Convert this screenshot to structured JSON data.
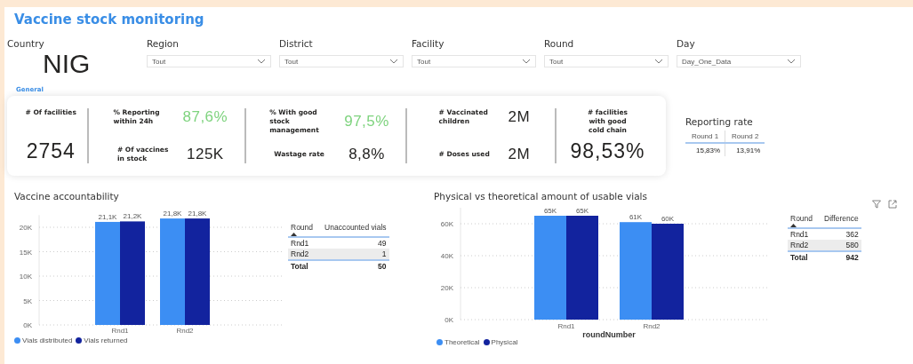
{
  "title": "Vaccine stock monitoring",
  "country": {
    "label": "Country",
    "value": "NIG"
  },
  "filters": [
    {
      "label": "Region",
      "value": "Tout"
    },
    {
      "label": "District",
      "value": "Tout"
    },
    {
      "label": "Facility",
      "value": "Tout"
    },
    {
      "label": "Round",
      "value": "Tout"
    },
    {
      "label": "Day",
      "value": "Day_One_Data"
    }
  ],
  "section_label": "General",
  "kpis": [
    {
      "kind": "single",
      "label": "# Of facilities",
      "value": "2754"
    },
    {
      "kind": "pair",
      "items": [
        {
          "label": "% Reporting within 24h",
          "value": "87,6%",
          "color": "#7ed37e"
        },
        {
          "label": "# Of  vaccines in stock",
          "value": "125K",
          "color": "#252423"
        }
      ]
    },
    {
      "kind": "pair",
      "items": [
        {
          "label": "% With good stock management",
          "value": "97,5%",
          "color": "#7ed37e"
        },
        {
          "label": "Wastage rate",
          "value": "8,8%",
          "color": "#252423"
        }
      ]
    },
    {
      "kind": "pair",
      "items": [
        {
          "label": "# Vaccinated children",
          "value": "2M",
          "color": "#252423"
        },
        {
          "label": "# Doses used",
          "value": "2M",
          "color": "#252423"
        }
      ]
    },
    {
      "kind": "single",
      "label": "# facilities with good cold chain",
      "value": "98,53%"
    }
  ],
  "reporting_rate": {
    "title": "Reporting rate",
    "columns": [
      "Round 1",
      "Round 2"
    ],
    "rows": [
      [
        "15,83%",
        "13,91%"
      ]
    ]
  },
  "charts": [
    {
      "title": "Vaccine accountability",
      "chart_data": {
        "type": "bar",
        "categories": [
          "Rnd1",
          "Rnd2"
        ],
        "grid": true,
        "ylim": [
          0,
          22500
        ],
        "yticks": [
          {
            "value": 0,
            "label": "0K"
          },
          {
            "value": 5000,
            "label": "5K"
          },
          {
            "value": 10000,
            "label": "10K"
          },
          {
            "value": 15000,
            "label": "15K"
          },
          {
            "value": 20000,
            "label": "20K"
          }
        ],
        "data_labels": true,
        "series": [
          {
            "name": "Vials distributed",
            "color": "#3c8ef3",
            "values": [
              21100,
              21800
            ],
            "value_labels": [
              "21,1K",
              "21,8K"
            ]
          },
          {
            "name": "Vials returned",
            "color": "#12239e",
            "values": [
              21200,
              21800
            ],
            "value_labels": [
              "21,2K",
              "21,8K"
            ]
          }
        ]
      },
      "table": {
        "columns": [
          "Round",
          "Unaccounted vials"
        ],
        "rows": [
          {
            "cells": [
              "Rnd1",
              "49"
            ],
            "highlighted": false
          },
          {
            "cells": [
              "Rnd2",
              "1"
            ],
            "highlighted": true
          }
        ],
        "total": [
          "Total",
          "50"
        ]
      }
    },
    {
      "title": "Physical vs theoretical amount of usable vials",
      "chart_data": {
        "type": "bar",
        "categories": [
          "Rnd1",
          "Rnd2"
        ],
        "xlabel": "roundNumber",
        "grid": true,
        "ylim": [
          0,
          70000
        ],
        "yticks": [
          {
            "value": 0,
            "label": "0K"
          },
          {
            "value": 20000,
            "label": "20K"
          },
          {
            "value": 40000,
            "label": "40K"
          },
          {
            "value": 60000,
            "label": "60K"
          }
        ],
        "data_labels": true,
        "series": [
          {
            "name": "Theoretical",
            "color": "#3c8ef3",
            "values": [
              65000,
              61000
            ],
            "value_labels": [
              "65K",
              "61K"
            ]
          },
          {
            "name": "Physical",
            "color": "#12239e",
            "values": [
              65000,
              60000
            ],
            "value_labels": [
              "65K",
              "60K"
            ]
          }
        ]
      },
      "table": {
        "columns": [
          "Round",
          "Difference"
        ],
        "rows": [
          {
            "cells": [
              "Rnd1",
              "362"
            ],
            "highlighted": false
          },
          {
            "cells": [
              "Rnd2",
              "580"
            ],
            "highlighted": true
          }
        ],
        "total": [
          "Total",
          "942"
        ]
      }
    }
  ]
}
